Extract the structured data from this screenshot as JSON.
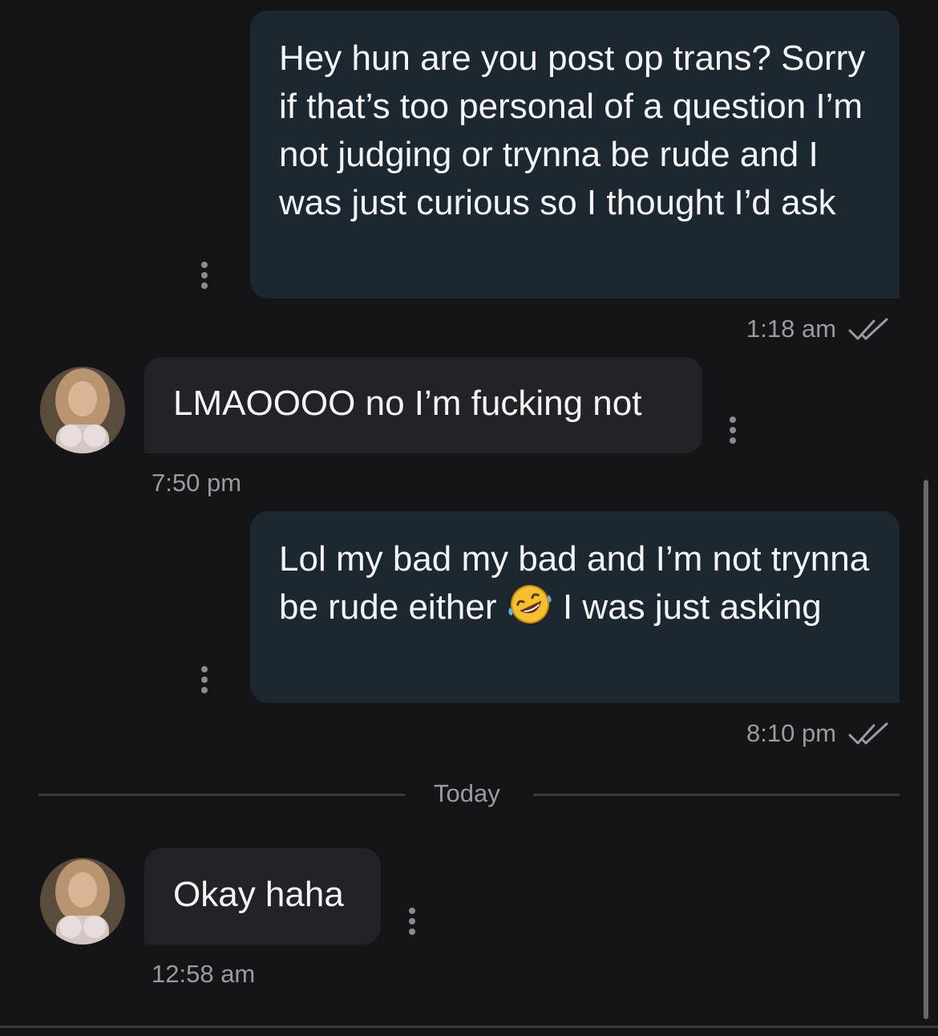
{
  "messages": [
    {
      "direction": "outgoing",
      "text": "Hey hun are you post op trans? Sorry if that’s too personal of a question I’m not judging or trynna be rude and I was just curious so I thought I’d ask",
      "time": "1:18 am",
      "status_icon": "double-check-icon"
    },
    {
      "direction": "incoming",
      "text": "LMAOOOO no I’m fucking not",
      "time": "7:50 pm",
      "avatar_icon": "contact-avatar"
    },
    {
      "direction": "outgoing",
      "text_before_emoji": "Lol my bad my bad and I’m not trynna be rude either ",
      "emoji": "rolling-on-the-floor-laughing-emoji",
      "text_after_emoji": " I was just asking",
      "time": "8:10 pm",
      "status_icon": "double-check-icon"
    },
    {
      "direction": "incoming",
      "text": "Okay haha",
      "time": "12:58 am",
      "avatar_icon": "contact-avatar"
    }
  ],
  "date_divider": "Today",
  "colors": {
    "background": "#151417",
    "outgoing_bubble": "#1c2730",
    "incoming_bubble": "#232226",
    "meta_text": "#9a9aa0"
  }
}
